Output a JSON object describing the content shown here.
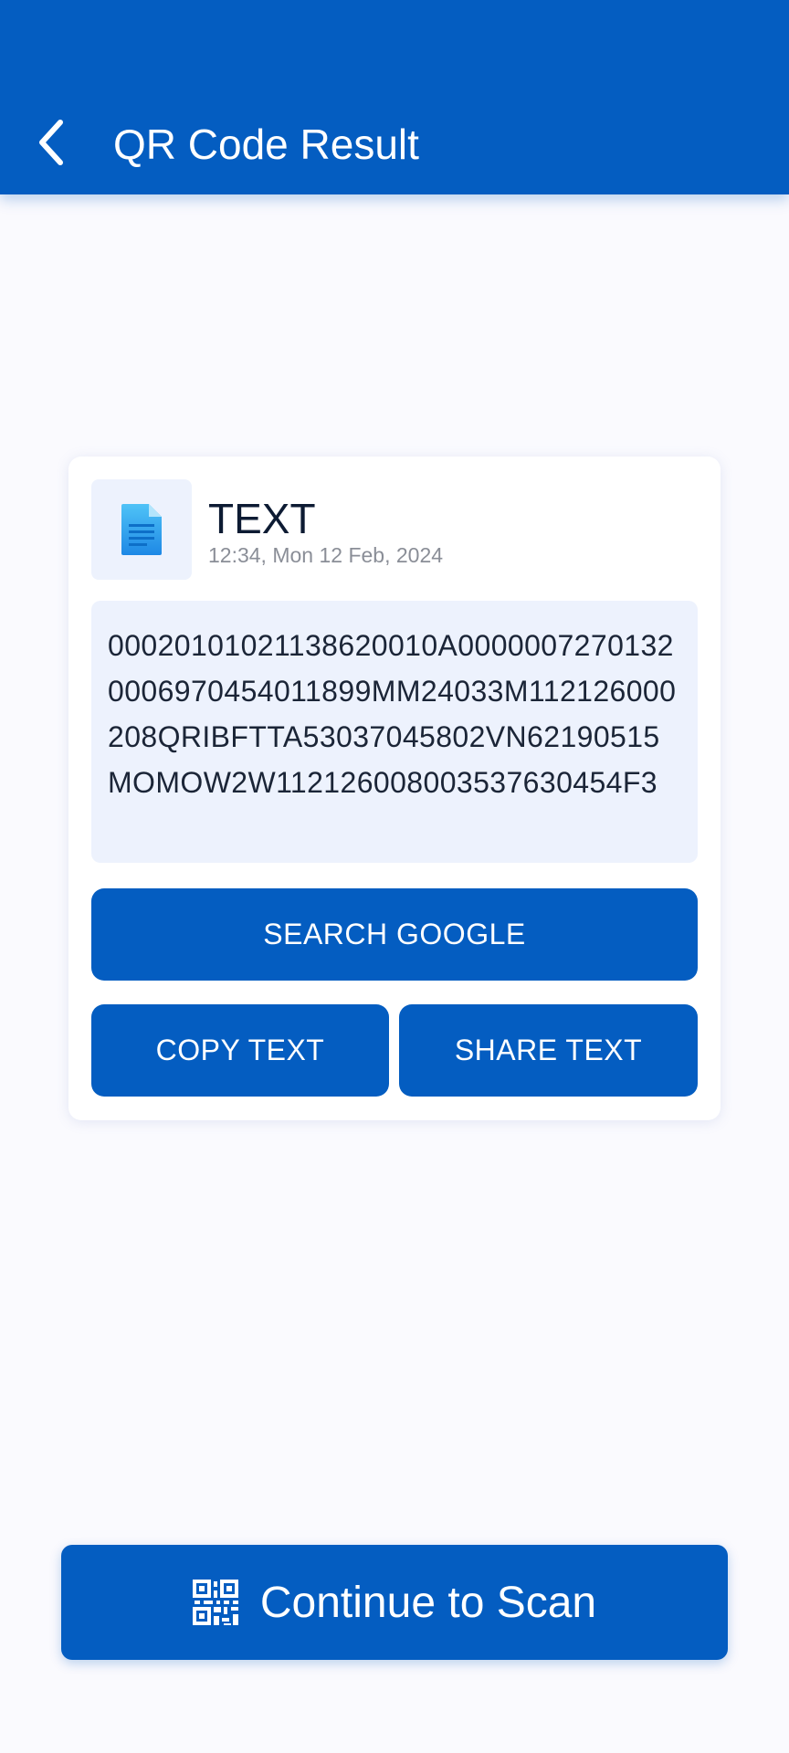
{
  "app_bar": {
    "back_icon": "chevron-left-icon",
    "title": "QR Code Result"
  },
  "result": {
    "type_icon": "document-icon",
    "type_label": "TEXT",
    "timestamp": "12:34, Mon 12 Feb, 2024",
    "content": "00020101021138620010A00000072701320006970454011899MM24033M112126000208QRIBFTTA53037045802VN62190515MOMOW2W112126008003537630454F3",
    "search_label": "SEARCH GOOGLE",
    "copy_label": "COPY TEXT",
    "share_label": "SHARE TEXT"
  },
  "footer": {
    "qr_icon": "qr-code-icon",
    "continue_label": "Continue to Scan"
  },
  "colors": {
    "primary": "#045dc1",
    "background": "#fafafe",
    "surface": "#edf2fd"
  }
}
